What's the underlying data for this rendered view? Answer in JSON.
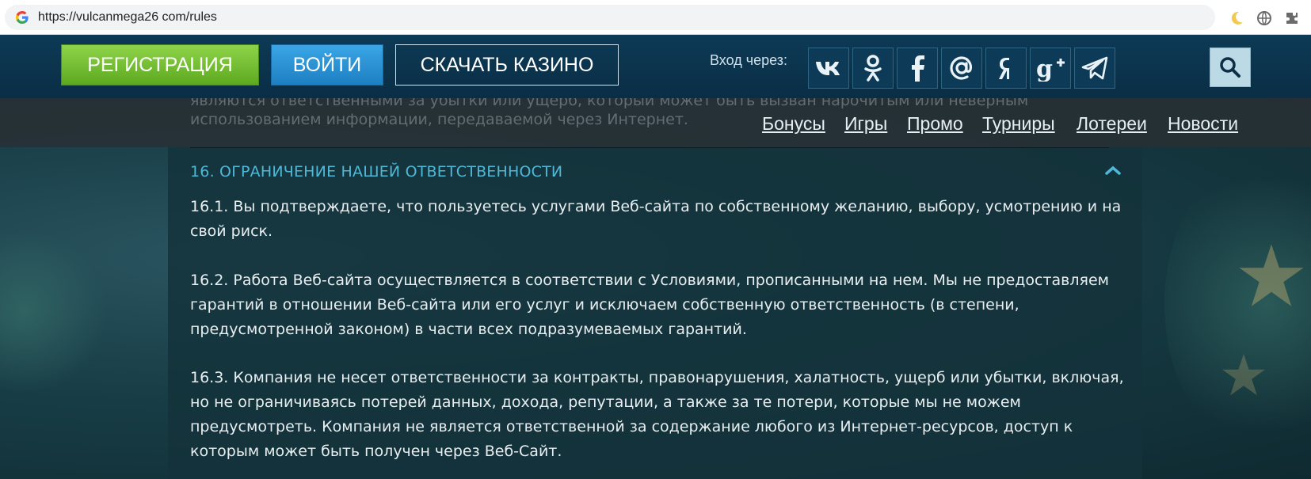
{
  "browser": {
    "url": "https://vulcanmega26 com/rules"
  },
  "header": {
    "register_label": "РЕГИСТРАЦИЯ",
    "login_label": "ВОЙТИ",
    "download_label": "СКАЧАТЬ КАЗИНО",
    "login_via_label": "Вход через:",
    "social": [
      {
        "name": "vk-icon",
        "glyph": "vk"
      },
      {
        "name": "odnoklassniki-icon",
        "glyph": "ok"
      },
      {
        "name": "facebook-icon",
        "glyph": "f"
      },
      {
        "name": "mail-icon",
        "glyph": "@"
      },
      {
        "name": "yandex-icon",
        "glyph": "Я"
      },
      {
        "name": "google-plus-icon",
        "glyph": "g+"
      },
      {
        "name": "telegram-icon",
        "glyph": "tg"
      }
    ]
  },
  "subnav": {
    "faded_text_1": "являются ответственными за убытки или ущерб, который может быть вызван нарочитым или неверным",
    "faded_text_2": "использованием информации, передаваемой через Интернет.",
    "links": [
      "Бонусы",
      "Игры",
      "Промо",
      "Турниры",
      "Лотереи",
      "Новости"
    ]
  },
  "section": {
    "title": "16. ОГРАНИЧЕНИЕ НАШЕЙ ОТВЕТСТВЕННОСТИ",
    "paragraphs": [
      "16.1. Вы подтверждаете, что пользуетесь услугами Веб-сайта по собственному желанию, выбору, усмотрению и на свой риск.",
      "16.2. Работа Веб-сайта осуществляется в соответствии с Условиями, прописанными на нем. Мы не предоставляем гарантий в отношении Веб-сайта или его услуг и исключаем собственную ответственность (в степени, предусмотренной законом) в части всех подразумеваемых гарантий.",
      "16.3. Компания не несет ответственности за контракты, правонарушения, халатность, ущерб или убытки, включая, но не ограничиваясь потерей данных, дохода, репутации, а также за те потери, которые мы не можем предусмотреть. Компания не является ответственной за содержание любого из Интернет-ресурсов, доступ к которым может быть получен через Веб-Сайт."
    ]
  },
  "colors": {
    "register_bg": "#6fbf2f",
    "login_bg": "#2a93d6",
    "title_accent": "#4fb8d6",
    "header_bg": "#0d3a56"
  }
}
